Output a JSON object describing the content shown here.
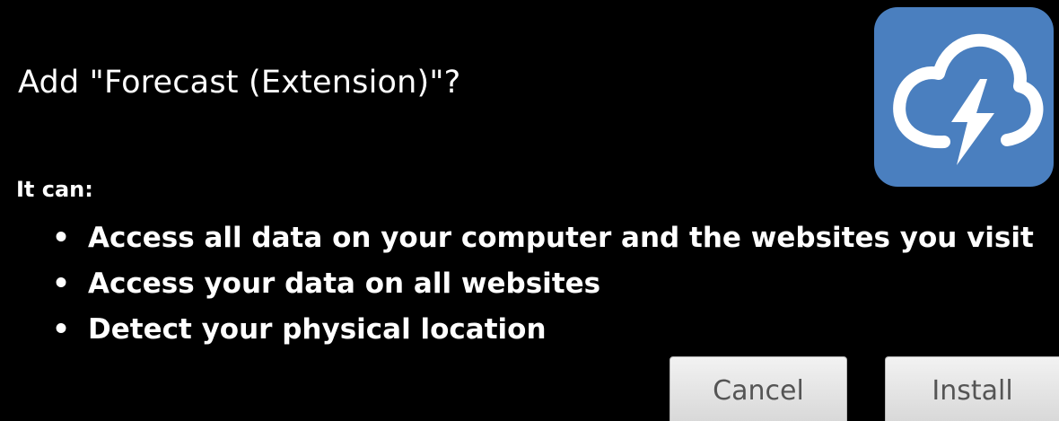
{
  "dialog": {
    "title": "Add \"Forecast (Extension)\"?",
    "icon": {
      "name": "cloud-lightning-icon",
      "background_color": "#4a7fbf",
      "foreground_color": "#ffffff"
    },
    "permissions_heading": "It can:",
    "permissions": [
      "Access all data on your computer and the websites you visit",
      "Access your data on all websites",
      "Detect your physical location"
    ],
    "bullet_glyph": "•",
    "buttons": {
      "cancel_label": "Cancel",
      "install_label": "Install"
    }
  }
}
